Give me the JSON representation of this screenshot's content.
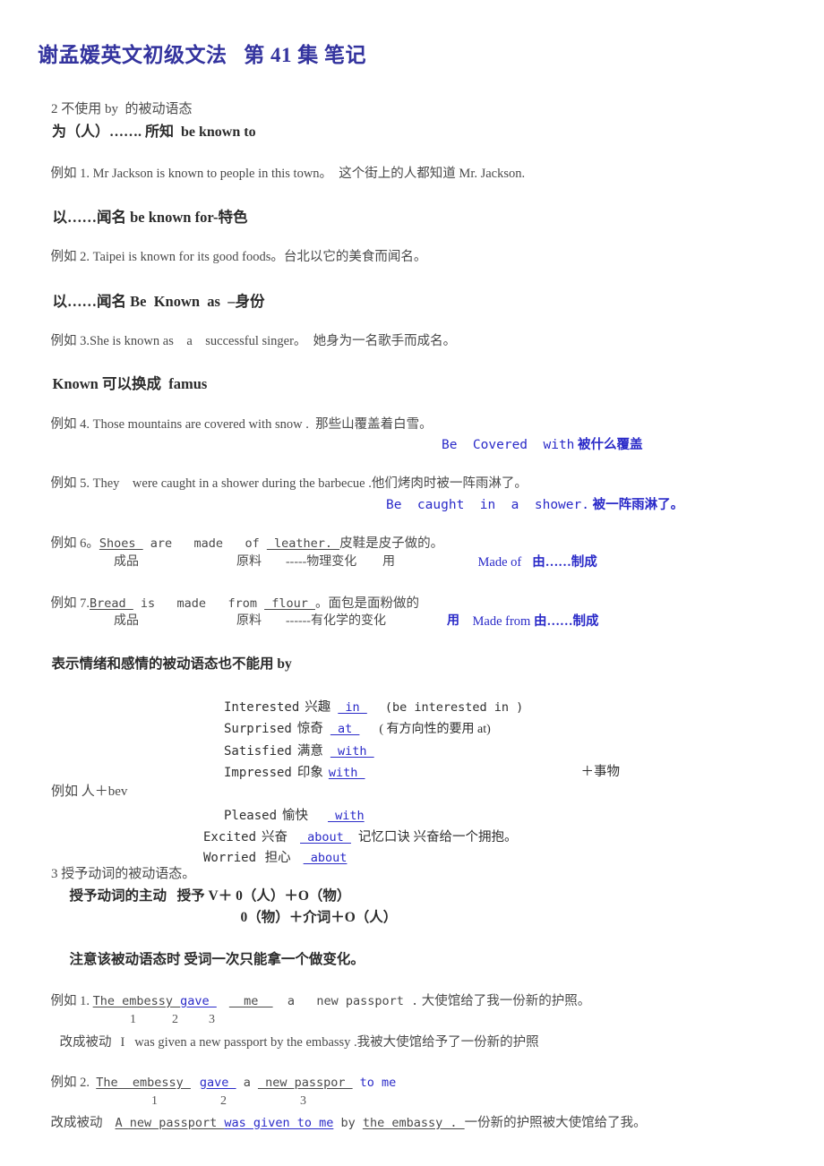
{
  "document": {
    "title": "谢孟媛英文初级文法   第 41 集 笔记",
    "colors": {
      "title": "#33339e",
      "annotation_blue": "#2a2ac8",
      "body_text": "#3a3a3a",
      "background": "#ffffff"
    }
  },
  "sections": {
    "s2_heading_line1": "2 不使用 by  的被动语态",
    "s2_heading_line2": "为（人）……. 所知  be known to",
    "example1": "例如 1. Mr Jackson is known to people in this town。  这个街上的人都知道 Mr. Jackson.",
    "heading_known_for": "以……闻名 be known for-特色",
    "example2": "例如 2. Taipei is known for its good foods。台北以它的美食而闻名。",
    "heading_known_as": "以……闻名 Be  Known  as  –身份",
    "example3": "例如 3.She is known as    a    successful singer。  她身为一名歌手而成名。",
    "heading_famus": "Known 可以换成  famus",
    "example4": "例如 4. Those mountains are covered with snow .  那些山覆盖着白雪。",
    "annot4_en": "Be  Covered  with",
    "annot4_cn": " 被什么覆盖",
    "example5": "例如 5. They    were caught in a shower during the barbecue .他们烤肉时被一阵雨淋了。",
    "annot5_en": "Be  caught  in  a  shower.",
    "annot5_cn": " 被一阵雨淋了。",
    "example6": {
      "prefix": "例如 6。",
      "w1": "Shoes ",
      "mid1": " are   made   of ",
      "w2": " leather. ",
      "cn": "皮鞋是皮子做的。",
      "note_a": "成品",
      "note_b": "原料",
      "note_c": "-----物理变化",
      "note_d": "用",
      "note_en": "Made of",
      "note_cn": "由……制成"
    },
    "example7": {
      "prefix": "例如 7.",
      "w1": "Bread ",
      "mid1": " is   made   from ",
      "w2": " flour ",
      "cn": "。面包是面粉做的",
      "note_a": "成品",
      "note_b": "原料",
      "note_c": "------有化学的变化",
      "note_d": "用",
      "note_en": "Made from ",
      "note_cn": "由……制成"
    },
    "heading_emotion": "表示情绪和感情的被动语态也不能用 by",
    "emotion_rows": [
      {
        "word": "Interested",
        "cn": "兴趣",
        "prep": " in ",
        "note": "(be interested in )"
      },
      {
        "word": "Surprised",
        "cn": "惊奇",
        "prep": " at ",
        "note": "( 有方向性的要用 at)"
      },
      {
        "word": "Satisfied",
        "cn": "满意",
        "prep": " with ",
        "note": ""
      },
      {
        "word": "Impressed",
        "cn": "印象",
        "prep": "with ",
        "note": ""
      }
    ],
    "emotion_right_note": "＋事物",
    "example_person_bev": "例如 人＋bev",
    "emotion_rows2": [
      {
        "word": "Pleased",
        "cn": "愉快",
        "prep": " with",
        "note": ""
      },
      {
        "word": "Excited",
        "cn": "兴奋",
        "prep": " about ",
        "note": "记忆口诀 兴奋给一个拥抱。"
      },
      {
        "word": "Worried",
        "cn": " 担心",
        "prep": " about",
        "note": ""
      }
    ],
    "s3_heading": "3 授予动词的被动语态。",
    "s3_line1": "授予动词的主动   授予 V＋ 0（人）＋O（物）",
    "s3_line2": "0（物）＋介词＋O（人）",
    "s3_note": "注意该被动语态时 受词一次只能拿一个做变化。",
    "ex1": {
      "prefix": "例如 1. ",
      "w1": "The embessy ",
      "w2": "gave ",
      "w3": "  me  ",
      "rest": "  a   new passport .",
      "cn": " 大使馆给了我一份新的护照。",
      "nums": [
        "1",
        "2",
        "3"
      ],
      "passive_label": "改成被动",
      "passive_text": "I   was given a new passport by the embassy .我被大使馆给予了一份新的护照"
    },
    "ex2": {
      "prefix": "例如 2.  ",
      "w1": "The  embessy ",
      "w2": "gave ",
      "mid": " a ",
      "w3": " new passpor ",
      "w4": "to me",
      "nums": [
        "1",
        "2",
        "3"
      ],
      "passive_label": "改成被动",
      "p1": "A new passport ",
      "p2": "was given to me",
      "p3": " by ",
      "p4": "the embassy . ",
      "p5": "一份新的护照被大使馆给了我。"
    }
  }
}
